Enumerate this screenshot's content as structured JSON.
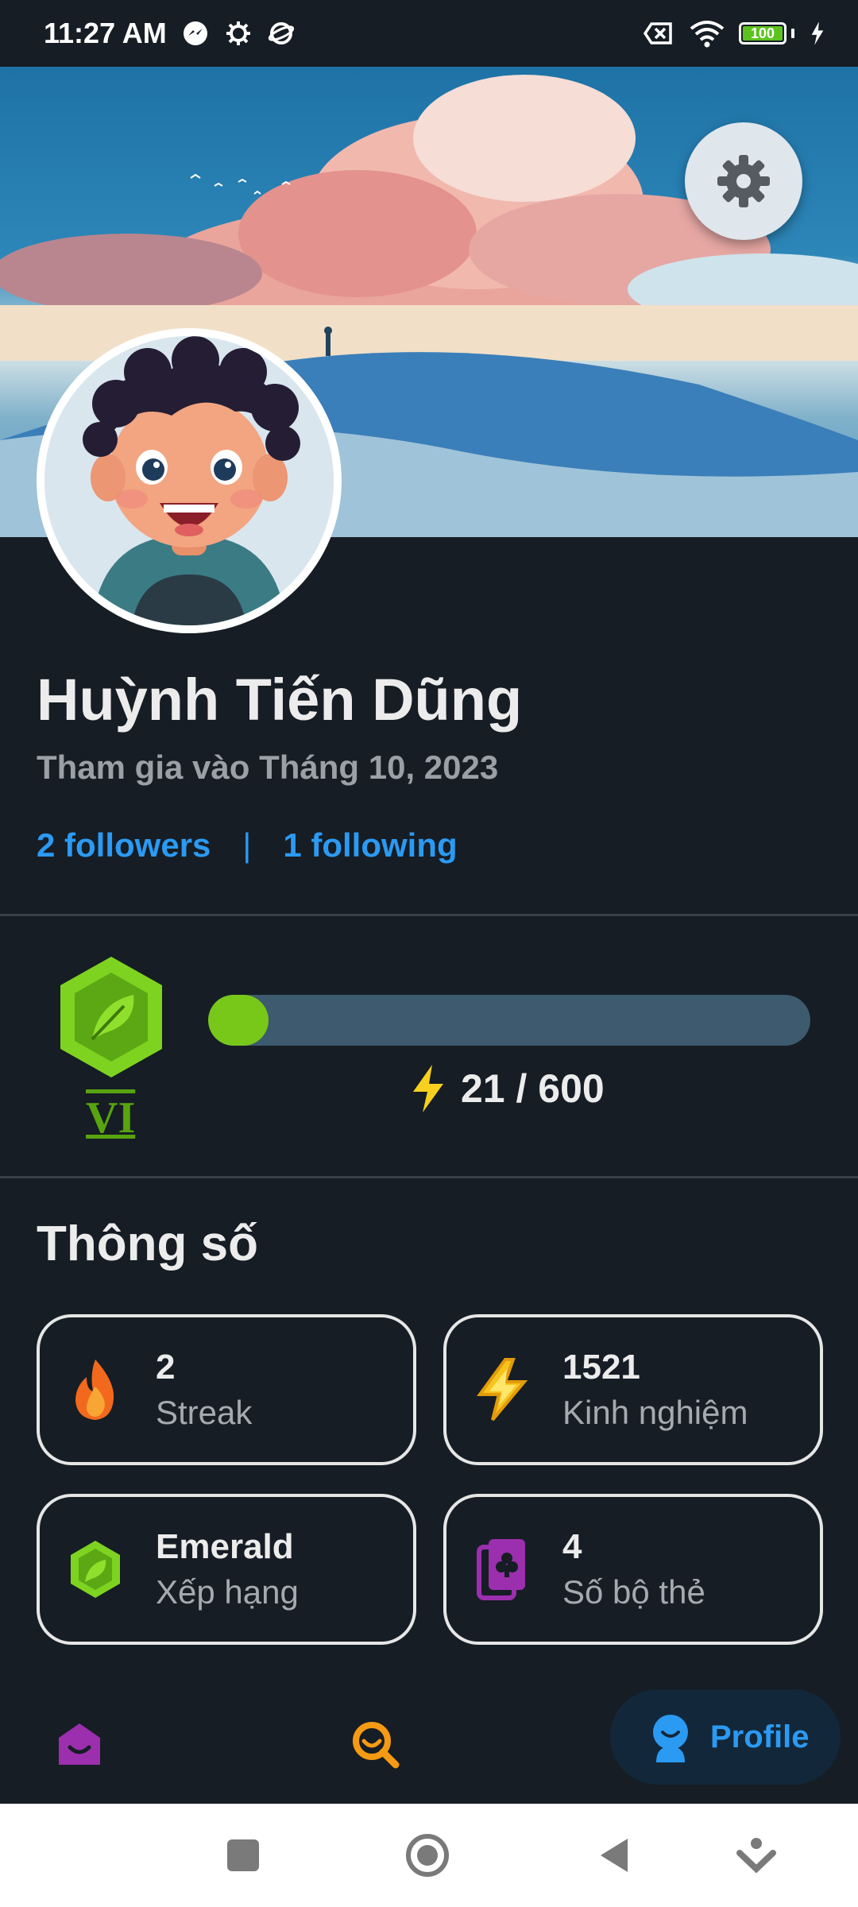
{
  "status_bar": {
    "time": "11:27 AM",
    "battery": "100",
    "icons": [
      "messenger-icon",
      "gear-icon",
      "planet-icon",
      "no-sim-icon",
      "wifi-icon",
      "battery-icon",
      "charging-icon"
    ]
  },
  "profile": {
    "name": "Huỳnh Tiến Dũng",
    "joined": "Tham gia vào Tháng 10, 2023",
    "followers": "2 followers",
    "separator": "|",
    "following": "1 following"
  },
  "level": {
    "roman": "VI",
    "xp_text": "21 / 600",
    "progress_fraction": 0.035
  },
  "stats": {
    "heading": "Thông số",
    "items": [
      {
        "value": "2",
        "label": "Streak",
        "icon": "fire-icon"
      },
      {
        "value": "1521",
        "label": "Kinh nghiệm",
        "icon": "lightning-icon"
      },
      {
        "value": "Emerald",
        "label": "Xếp hạng",
        "icon": "emerald-league-icon"
      },
      {
        "value": "4",
        "label": "Số bộ thẻ",
        "icon": "card-decks-icon"
      }
    ]
  },
  "nav": {
    "home": "home-icon",
    "search": "search-icon",
    "profile_label": "Profile"
  },
  "colors": {
    "background": "#161d24",
    "accent_blue": "#2b9af3",
    "xp_green": "#78c81a",
    "xp_track": "#3d5a6e",
    "level_green": "#7ed321"
  }
}
